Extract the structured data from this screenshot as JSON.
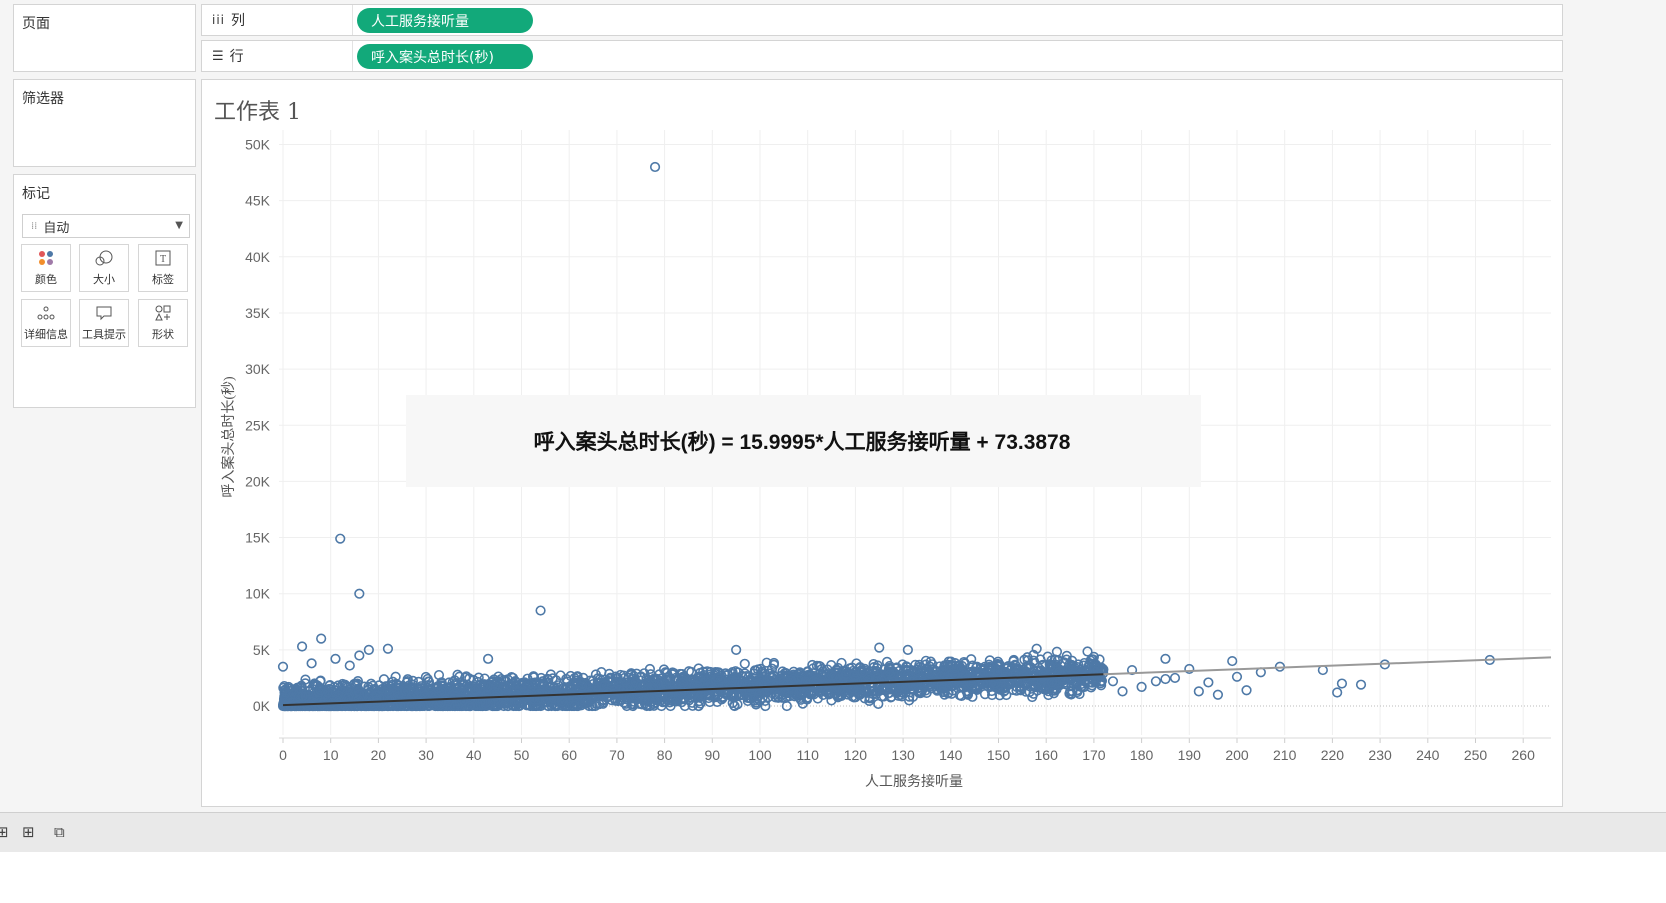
{
  "panels": {
    "pages_title": "页面",
    "filters_title": "筛选器",
    "marks_title": "标记",
    "mark_type": "自动",
    "mark_buttons": [
      {
        "label": "颜色",
        "icon": "color-dots-icon"
      },
      {
        "label": "大小",
        "icon": "size-icon"
      },
      {
        "label": "标签",
        "icon": "label-icon"
      },
      {
        "label": "详细信息",
        "icon": "detail-icon"
      },
      {
        "label": "工具提示",
        "icon": "tooltip-icon"
      },
      {
        "label": "形状",
        "icon": "shape-icon"
      }
    ]
  },
  "shelves": {
    "columns_label": "列",
    "rows_label": "行",
    "columns_pill": "人工服务接听量",
    "rows_pill": "呼入案头总时长(秒)"
  },
  "worksheet": {
    "title": "工作表 1",
    "trend_equation": "呼入案头总时长(秒) = 15.9995*人工服务接听量 + 73.3878"
  },
  "colors": {
    "pill": "#12a97a",
    "mark": "#4e79a7",
    "trend": "#333333",
    "trend_extension": "#999999"
  },
  "chart_data": {
    "type": "scatter",
    "xlabel": "人工服务接听量",
    "ylabel": "呼入案头总时长(秒)",
    "xlim": [
      -2,
      266
    ],
    "ylim": [
      -3000,
      52000
    ],
    "x_ticks": [
      0,
      10,
      20,
      30,
      40,
      50,
      60,
      70,
      80,
      90,
      100,
      110,
      120,
      130,
      140,
      150,
      160,
      170,
      180,
      190,
      200,
      210,
      220,
      230,
      240,
      250,
      260
    ],
    "y_ticks": [
      0,
      5000,
      10000,
      15000,
      20000,
      25000,
      30000,
      35000,
      40000,
      45000,
      50000
    ],
    "y_tick_labels": [
      "0K",
      "5K",
      "10K",
      "15K",
      "20K",
      "25K",
      "30K",
      "35K",
      "40K",
      "45K",
      "50K"
    ],
    "grid": true,
    "marker": "open-circle",
    "trend_line": {
      "slope": 15.9995,
      "intercept": 73.3878
    },
    "outliers": [
      [
        78,
        48000
      ],
      [
        12,
        14900
      ],
      [
        16,
        10000
      ],
      [
        54,
        8500
      ],
      [
        8,
        6000
      ],
      [
        4,
        5300
      ],
      [
        22,
        5100
      ],
      [
        18,
        5000
      ],
      [
        16,
        4500
      ],
      [
        0,
        3500
      ],
      [
        6,
        3800
      ],
      [
        11,
        4200
      ],
      [
        14,
        3600
      ],
      [
        43,
        4200
      ],
      [
        95,
        5000
      ],
      [
        125,
        5200
      ],
      [
        131,
        5000
      ],
      [
        158,
        5100
      ],
      [
        185,
        4200
      ],
      [
        199,
        4000
      ],
      [
        178,
        3200
      ],
      [
        190,
        3300
      ],
      [
        205,
        3000
      ],
      [
        209,
        3500
      ],
      [
        218,
        3200
      ],
      [
        231,
        3700
      ],
      [
        253,
        4100
      ],
      [
        226,
        1900
      ],
      [
        222,
        2000
      ],
      [
        221,
        1200
      ],
      [
        200,
        2600
      ],
      [
        202,
        1400
      ],
      [
        196,
        1000
      ],
      [
        194,
        2100
      ],
      [
        192,
        1300
      ],
      [
        187,
        2500
      ],
      [
        185,
        2400
      ],
      [
        180,
        1700
      ],
      [
        183,
        2200
      ],
      [
        176,
        1300
      ],
      [
        174,
        2200
      ]
    ],
    "cloud": {
      "x_range": [
        0,
        172
      ],
      "y_center_slope": 15.2,
      "y_center_intercept": 300,
      "y_spread": 1500,
      "count": 3500
    }
  }
}
